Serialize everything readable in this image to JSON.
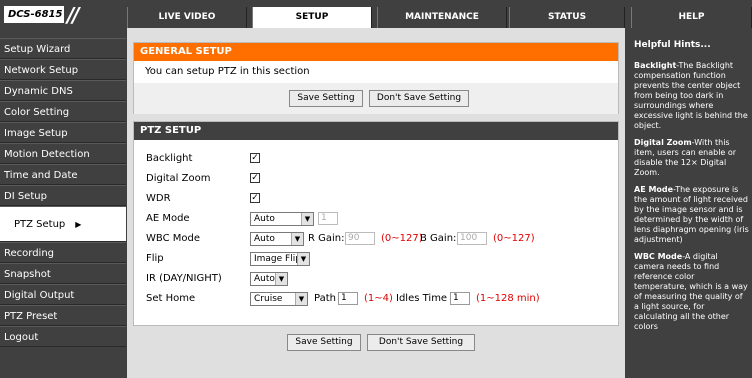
{
  "logo": {
    "model": "DCS-6815"
  },
  "tabs": [
    {
      "label": "LIVE VIDEO"
    },
    {
      "label": "SETUP"
    },
    {
      "label": "MAINTENANCE"
    },
    {
      "label": "STATUS"
    },
    {
      "label": "HELP"
    }
  ],
  "nav": [
    {
      "label": "Setup Wizard"
    },
    {
      "label": "Network Setup"
    },
    {
      "label": "Dynamic DNS"
    },
    {
      "label": "Color Setting"
    },
    {
      "label": "Image Setup"
    },
    {
      "label": "Motion Detection"
    },
    {
      "label": "Time and Date"
    },
    {
      "label": "DI Setup"
    },
    {
      "label": "PTZ Setup"
    },
    {
      "label": "Recording"
    },
    {
      "label": "Snapshot"
    },
    {
      "label": "Digital Output"
    },
    {
      "label": "PTZ Preset"
    },
    {
      "label": "Logout"
    }
  ],
  "general": {
    "title": "GENERAL SETUP",
    "text": "You can setup PTZ in this section",
    "save": "Save Setting",
    "dont_save": "Don't Save Setting"
  },
  "ptz": {
    "title": "PTZ SETUP",
    "backlight": "Backlight",
    "digital_zoom": "Digital Zoom",
    "wdr": "WDR",
    "ae_mode": "AE Mode",
    "ae_value": "Auto",
    "ae_input": "1",
    "wbc_mode": "WBC Mode",
    "wbc_value": "Auto",
    "r_gain_label": "R Gain:",
    "r_gain": "90",
    "r_range": "(0~127)",
    "b_gain_label": "B Gain:",
    "b_gain": "100",
    "b_range": "(0~127)",
    "flip": "Flip",
    "flip_value": "Image Flip",
    "ir": "IR (DAY/NIGHT)",
    "ir_value": "Auto",
    "set_home": "Set Home",
    "home_value": "Cruise",
    "path_label": "Path",
    "path_value": "1",
    "path_range": "(1~4)",
    "idles_label": "Idles Time",
    "idles_value": "1",
    "idles_range": "(1~128 min)",
    "checked_mark": "✓"
  },
  "bottom": {
    "save": "Save Setting",
    "dont_save": "Don't Save Setting"
  },
  "hints": {
    "title": "Helpful Hints...",
    "items": [
      {
        "term": "Backlight",
        "text": "-The Backlight compensation function prevents the center object from being too dark in surroundings where excessive light is behind the object."
      },
      {
        "term": "Digital Zoom",
        "text": "-With this item, users can enable or disable the 12× Digital Zoom."
      },
      {
        "term": "AE Mode",
        "text": "-The exposure is the amount of light received by the image sensor and is determined by the width of lens diaphragm opening (iris adjustment)"
      },
      {
        "term": "WBC Mode",
        "text": "-A digital camera needs to find reference color temperature, which is a way of measuring the quality of a light source, for calculating all the other colors"
      }
    ]
  }
}
